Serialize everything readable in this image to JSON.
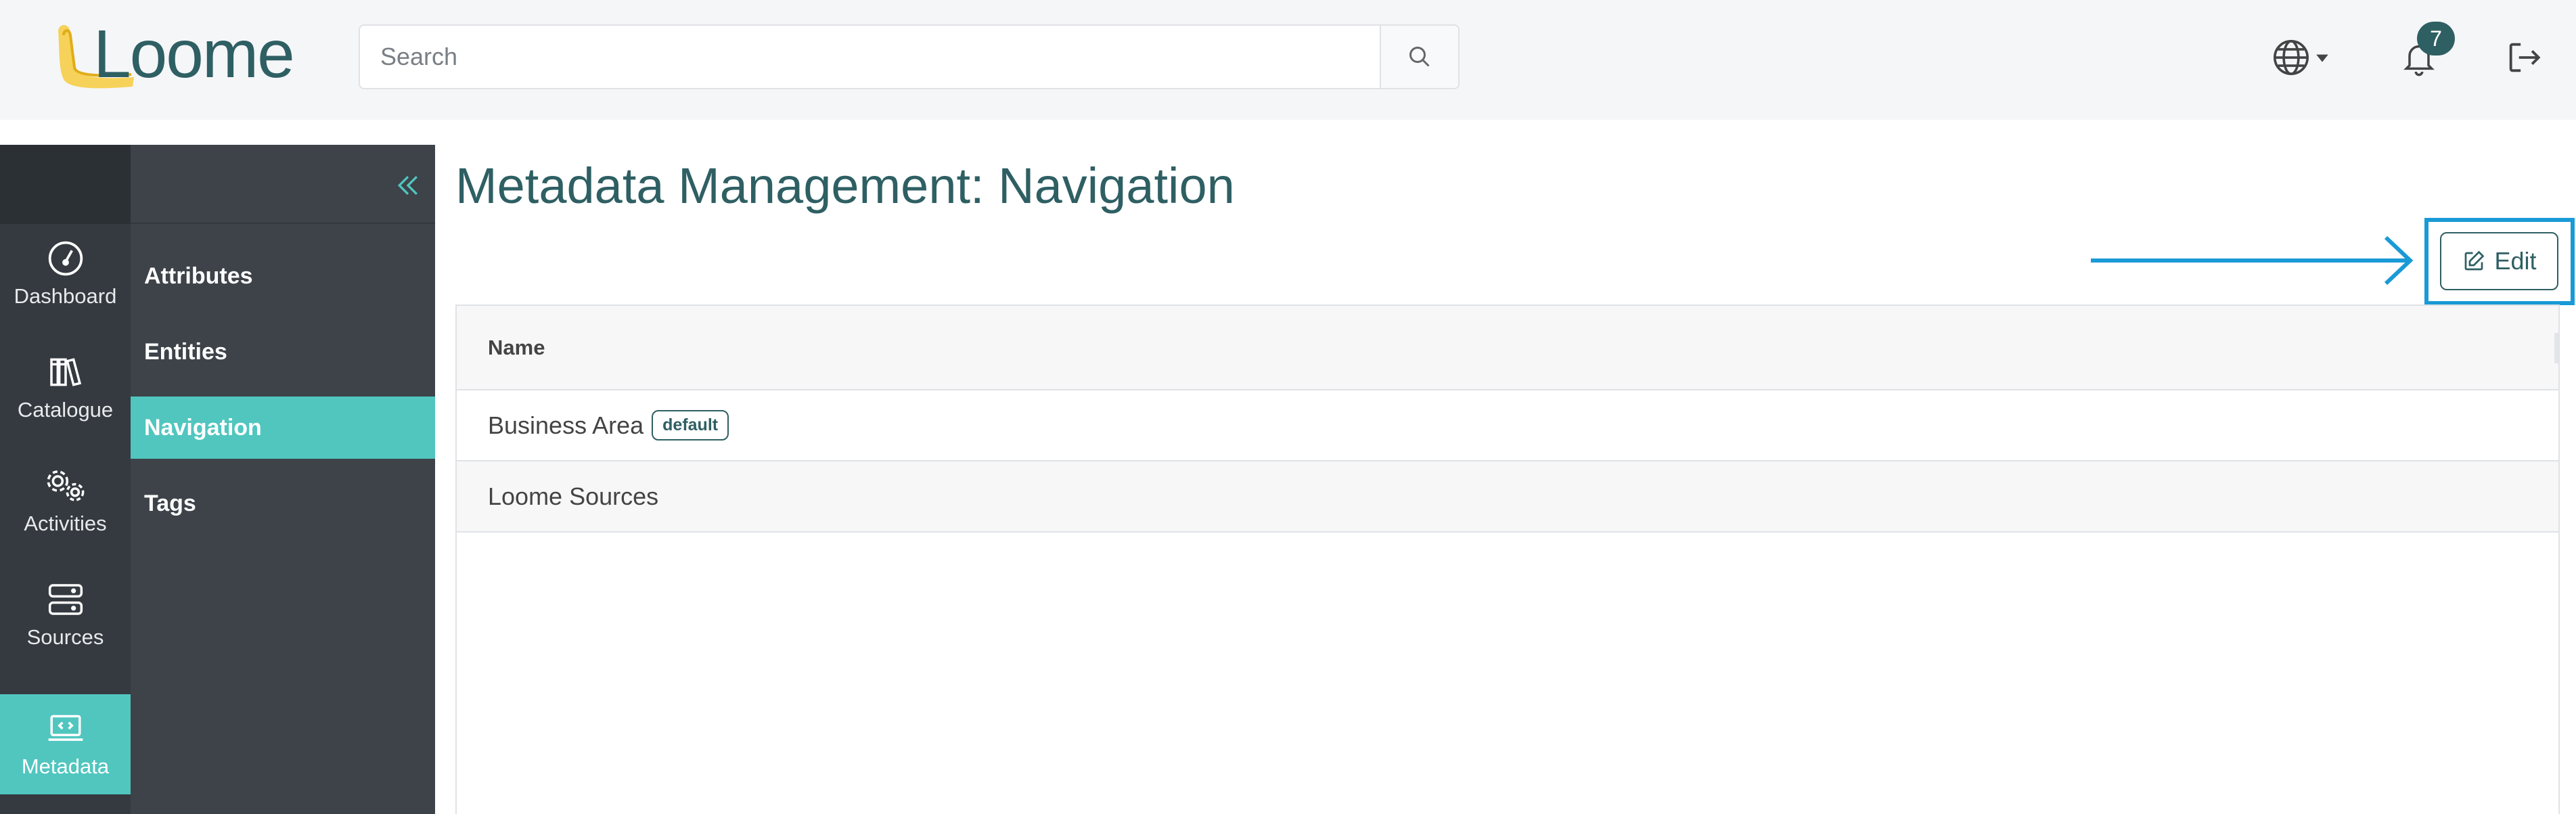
{
  "header": {
    "logo_text": "Loome",
    "search_placeholder": "Search",
    "notification_count": "7"
  },
  "rail": {
    "items": [
      {
        "label": "Dashboard",
        "icon": "dashboard-icon"
      },
      {
        "label": "Catalogue",
        "icon": "books-icon"
      },
      {
        "label": "Activities",
        "icon": "gears-icon"
      },
      {
        "label": "Sources",
        "icon": "server-icon"
      },
      {
        "label": "Metadata",
        "icon": "laptop-code-icon",
        "active": true
      }
    ]
  },
  "submenu": {
    "items": [
      {
        "label": "Attributes"
      },
      {
        "label": "Entities"
      },
      {
        "label": "Navigation",
        "active": true
      },
      {
        "label": "Tags"
      }
    ]
  },
  "main": {
    "title": "Metadata Management: Navigation",
    "edit_label": "Edit",
    "table": {
      "columns": [
        "Name"
      ],
      "rows": [
        {
          "name": "Business Area",
          "tag": "default"
        },
        {
          "name": "Loome Sources",
          "tag": ""
        }
      ]
    }
  },
  "colors": {
    "accent": "#50c6bf",
    "brand": "#2e5f63",
    "annotation": "#1a9ad6"
  }
}
